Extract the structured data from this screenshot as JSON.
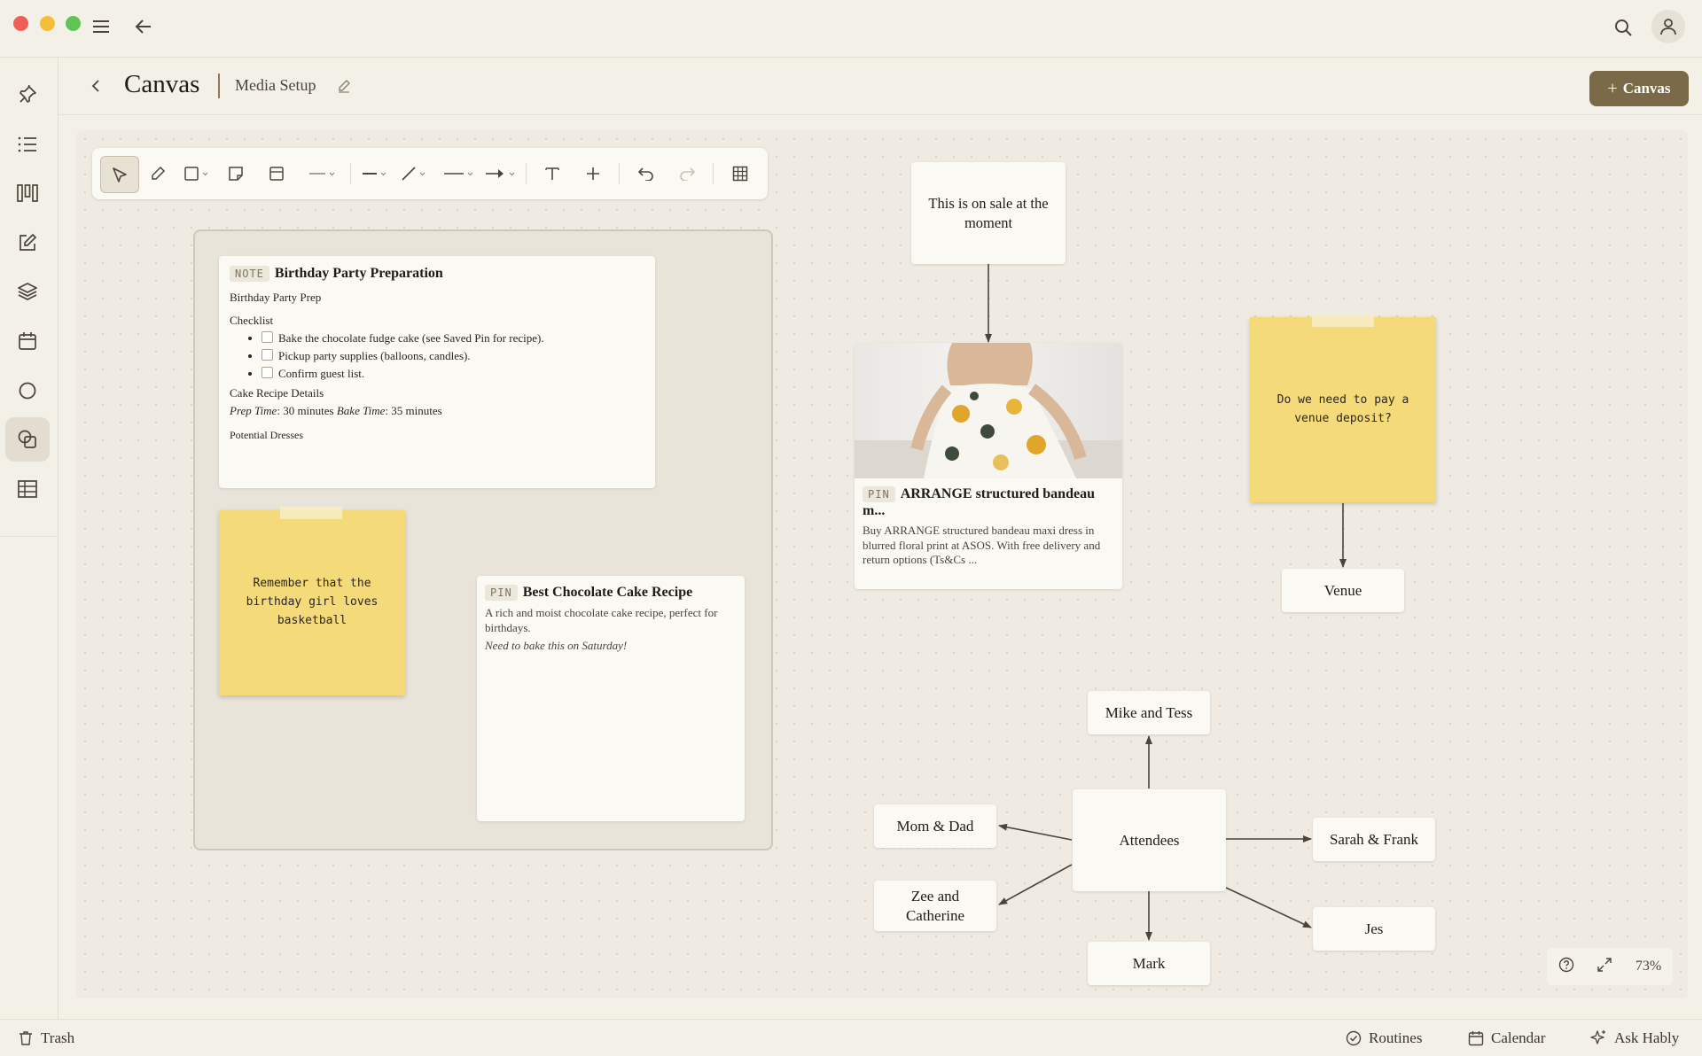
{
  "header": {
    "title": "Canvas",
    "subtitle": "Media Setup",
    "add_canvas_label": "Canvas"
  },
  "note_card": {
    "badge": "NOTE",
    "title": "Birthday Party Preparation",
    "line1": "Birthday Party Prep",
    "checklist_heading": "Checklist",
    "checklist": [
      "Bake the chocolate fudge cake (see Saved Pin for recipe).",
      "Pickup party supplies (balloons, candles).",
      "Confirm guest list."
    ],
    "recipe_heading": "Cake Recipe Details",
    "prep_label": "Prep Time",
    "prep_value": ": 30 minutes ",
    "bake_label": "Bake Time",
    "bake_value": ": 35 minutes",
    "dresses_heading": "Potential Dresses"
  },
  "sticky_basketball": "Remember that the birthday girl loves basketball",
  "cake_pin": {
    "badge": "PIN",
    "title": "Best Chocolate Cake Recipe",
    "desc": "A rich and moist chocolate cake recipe, perfect for birthdays.",
    "note": "Need to bake this on Saturday!"
  },
  "sale_note": "This is on sale at the moment",
  "dress_pin": {
    "badge": "PIN",
    "title": "ARRANGE structured bandeau m...",
    "desc": "Buy ARRANGE structured bandeau maxi dress in blurred floral print at ASOS. With free delivery and return options (Ts&Cs ..."
  },
  "sticky_venue": "Do we need to pay a venue deposit?",
  "nodes": {
    "venue": "Venue",
    "mike_tess": "Mike and Tess",
    "mom_dad": "Mom & Dad",
    "attendees": "Attendees",
    "sarah_frank": "Sarah & Frank",
    "zee_catherine": "Zee and Catherine",
    "jes": "Jes",
    "mark": "Mark"
  },
  "zoom": "73%",
  "bottom": {
    "trash": "Trash",
    "routines": "Routines",
    "calendar": "Calendar",
    "ask": "Ask Hably"
  },
  "colors": {
    "accent": "#7a6a47",
    "sticky": "#f5da7a",
    "close": "#ee5f57",
    "minimize": "#f6bd3b",
    "maximize": "#5fc454"
  }
}
